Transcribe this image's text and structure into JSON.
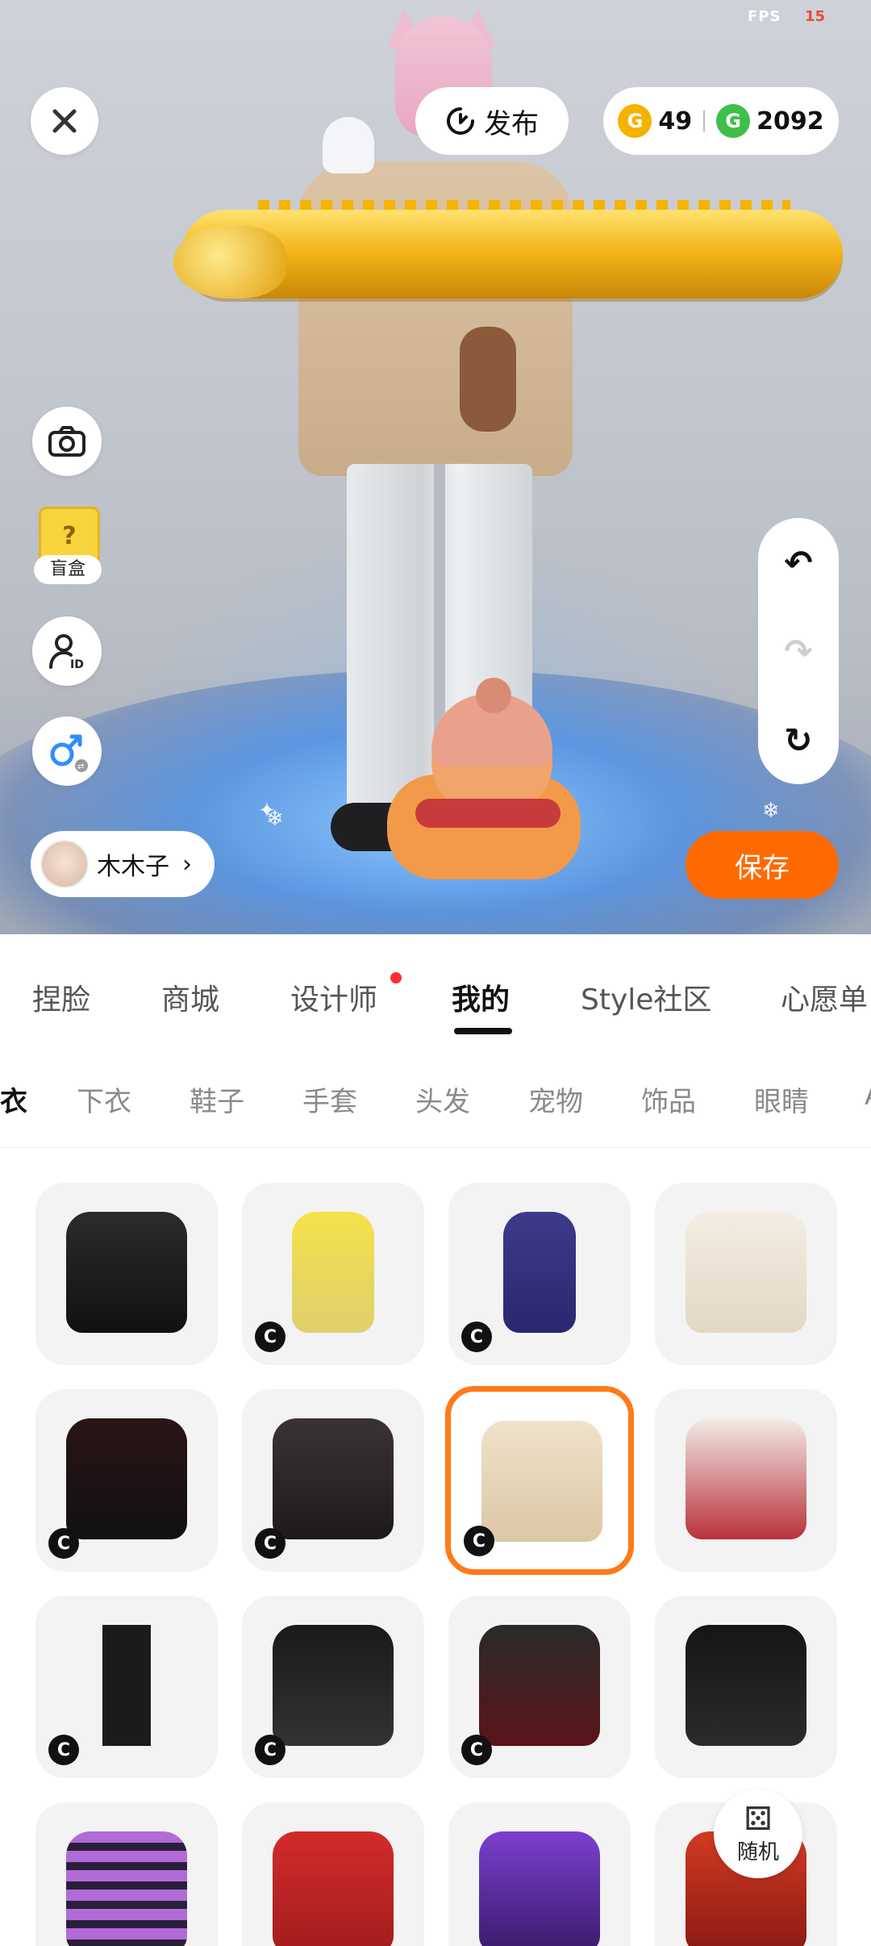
{
  "status": {
    "fps_label": "FPS",
    "fps_value": "15"
  },
  "top_bar": {
    "close_icon": "close-icon",
    "publish_label": "发布",
    "currency": {
      "gold": "49",
      "green": "2092"
    }
  },
  "left_tools": {
    "blind_box_label": "盲盒"
  },
  "user": {
    "name": "木木子"
  },
  "actions": {
    "save_label": "保存"
  },
  "main_tabs": [
    {
      "label": "捏脸"
    },
    {
      "label": "商城"
    },
    {
      "label": "设计师"
    },
    {
      "label": "我的"
    },
    {
      "label": "Style社区"
    },
    {
      "label": "心愿单"
    }
  ],
  "sub_tabs": [
    {
      "label": "上衣"
    },
    {
      "label": "下衣"
    },
    {
      "label": "鞋子"
    },
    {
      "label": "手套"
    },
    {
      "label": "头发"
    },
    {
      "label": "宠物"
    },
    {
      "label": "饰品"
    },
    {
      "label": "眼睛"
    },
    {
      "label": "A"
    }
  ],
  "grid": {
    "badge_glyph": "C",
    "random_label": "随机"
  },
  "colors": {
    "accent": "#ff6a00",
    "selected_border": "#ff7a1a",
    "notification_dot": "#ff2d2d"
  }
}
